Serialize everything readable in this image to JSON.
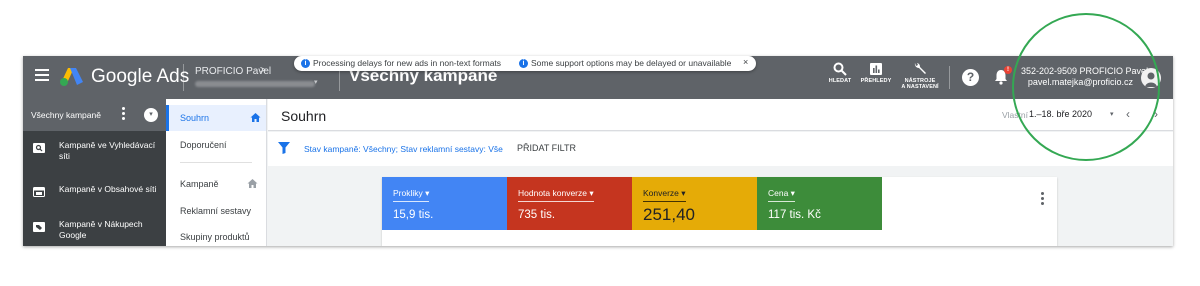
{
  "topbar": {
    "brand": "Google Ads",
    "account_name": "PROFICIO Pavel",
    "account_chevron": ">",
    "account_caret": "▾",
    "page_heading": "Všechny kampaně",
    "tools": {
      "search_label": "HLEDAT",
      "reports_label": "PŘEHLEDY",
      "tools_label_1": "NÁSTROJE",
      "tools_label_2": "A NASTAVENÍ"
    },
    "help_glyph": "?",
    "bell_badge": "!",
    "user_id": "352-202-9509 PROFICIO Pavel",
    "user_email": "pavel.matejka@proficio.cz"
  },
  "sidebar": {
    "title": "Všechny kampaně",
    "dropdown_glyph": "▾",
    "items": [
      {
        "label": "Kampaně ve Vyhledávací síti",
        "icon": "search-network-icon"
      },
      {
        "label": "Kampaně v Obsahové síti",
        "icon": "display-network-icon"
      },
      {
        "label": "Kampaně v Nákupech Google",
        "icon": "shopping-tag-icon"
      }
    ]
  },
  "subnav": {
    "items": [
      {
        "label": "Souhrn",
        "active": true
      },
      {
        "label": "Doporučení"
      },
      {
        "label": "Kampaně"
      },
      {
        "label": "Reklamní sestavy"
      },
      {
        "label": "Skupiny produktů"
      }
    ]
  },
  "main": {
    "title": "Souhrn",
    "notice": {
      "text1": "Processing delays for new ads in non-text formats",
      "text2": "Some support options may be delayed or unavailable",
      "info_glyph": "i",
      "close_glyph": "×"
    },
    "date": {
      "custom_label": "Vlastní",
      "range": "1.–18. bře 2020",
      "caret": "▾",
      "prev": "‹",
      "next": "›"
    },
    "filter": {
      "text": "Stav kampaně: Všechny; Stav reklamní sestavy: Vše",
      "add_label": "PŘIDAT FILTR"
    },
    "metrics": [
      {
        "label": "Prokliky ▾",
        "value": "15,9 tis.",
        "color": "#4285f4"
      },
      {
        "label": "Hodnota konverze ▾",
        "value": "735 tis.",
        "color": "#c5351f"
      },
      {
        "label": "Konverze ▾",
        "value": "251,40",
        "color": "#e5ab07"
      },
      {
        "label": "Cena ▾",
        "value": "117 tis. Kč",
        "color": "#3d8c3a"
      }
    ]
  },
  "colors": {
    "topbar": "#5f6368",
    "sidebar": "#3c4043",
    "accent": "#1a73e8",
    "highlight_circle": "#34a853"
  }
}
